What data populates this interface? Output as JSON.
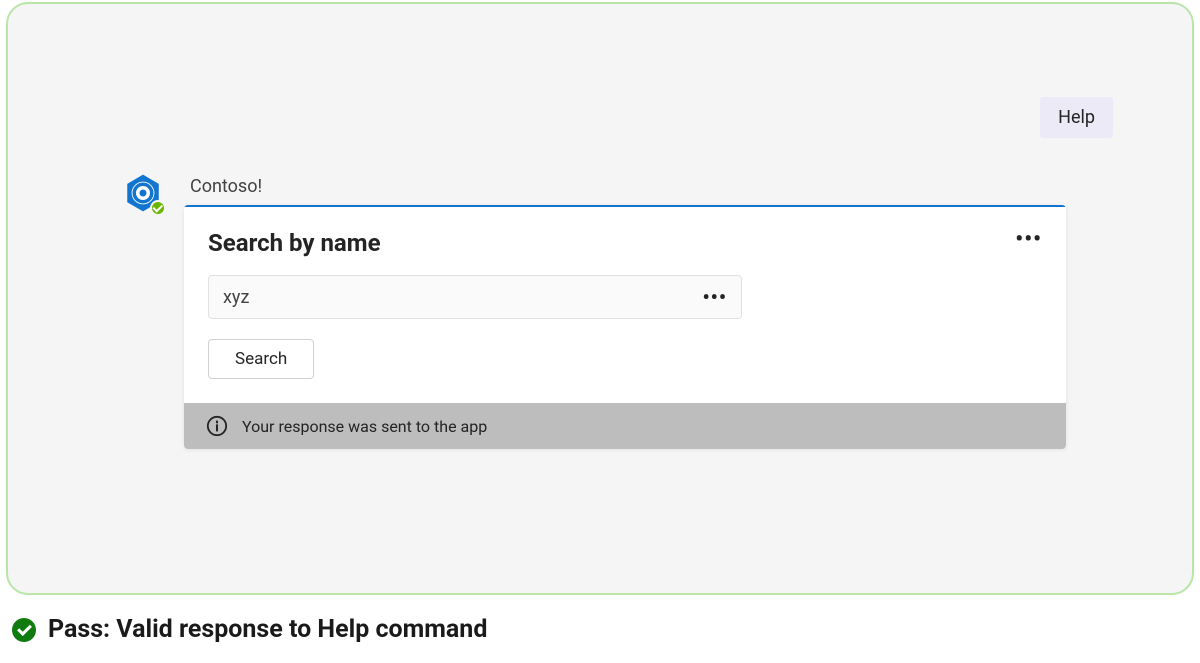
{
  "help_pill": "Help",
  "app": {
    "name": "Contoso!",
    "presence": "available"
  },
  "card": {
    "title": "Search by name",
    "input_value": "xyz",
    "search_button": "Search",
    "footer_text": "Your response was sent to the app"
  },
  "result": {
    "label": "Pass: Valid response to Help command",
    "status": "pass"
  }
}
